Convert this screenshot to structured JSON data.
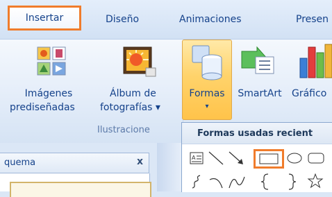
{
  "tabs": {
    "insertar": "Insertar",
    "diseno": "Diseño",
    "animaciones": "Animaciones",
    "presentacion": "Presen"
  },
  "ribbon": {
    "imagenes_line1": "Imágenes",
    "imagenes_line2": "prediseñadas",
    "album_line1": "Álbum de",
    "album_line2": "fotografías ▾",
    "formas": "Formas",
    "formas_arrow": "▾",
    "smartart": "SmartArt",
    "grafico": "Gráfico",
    "group_label": "Ilustracione"
  },
  "dropdown": {
    "title": "Formas usadas recient"
  },
  "pane": {
    "tab_label": "quema",
    "close": "x"
  },
  "colors": {
    "highlight_border": "#f07c2c",
    "tab_text": "#15428b",
    "ribbon_bg": "#e4edf9"
  }
}
